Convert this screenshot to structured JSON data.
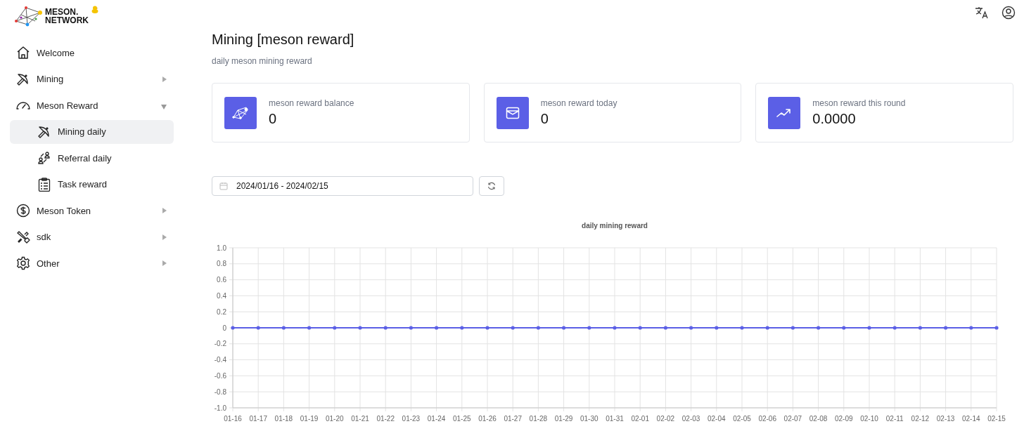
{
  "logo": {
    "line1": "MESON.",
    "line2": "NETWORK"
  },
  "sidebar": {
    "items": [
      {
        "label": "Welcome",
        "kind": "link",
        "selected": false
      },
      {
        "label": "Mining",
        "kind": "group",
        "expanded": false,
        "selected": false
      },
      {
        "label": "Meson Reward",
        "kind": "group",
        "expanded": true,
        "selected": false,
        "children": [
          {
            "label": "Mining daily",
            "selected": true
          },
          {
            "label": "Referral daily",
            "selected": false
          },
          {
            "label": "Task reward",
            "selected": false
          }
        ]
      },
      {
        "label": "Meson Token",
        "kind": "group",
        "expanded": false,
        "selected": false
      },
      {
        "label": "sdk",
        "kind": "group",
        "expanded": false,
        "selected": false
      },
      {
        "label": "Other",
        "kind": "group",
        "expanded": false,
        "selected": false
      }
    ]
  },
  "page": {
    "title": "Mining [meson reward]",
    "subtitle": "daily meson mining reward"
  },
  "cards": [
    {
      "label": "meson reward balance",
      "value": "0"
    },
    {
      "label": "meson reward today",
      "value": "0"
    },
    {
      "label": "meson reward this round",
      "value": "0.0000"
    }
  ],
  "date_range": {
    "value": "2024/01/16 - 2024/02/15"
  },
  "chart": {
    "chart_data": {
      "type": "line",
      "title": "daily mining reward",
      "categories": [
        "01-16",
        "01-17",
        "01-18",
        "01-19",
        "01-20",
        "01-21",
        "01-22",
        "01-23",
        "01-24",
        "01-25",
        "01-26",
        "01-27",
        "01-28",
        "01-29",
        "01-30",
        "01-31",
        "02-01",
        "02-02",
        "02-03",
        "02-04",
        "02-05",
        "02-06",
        "02-07",
        "02-08",
        "02-09",
        "02-10",
        "02-11",
        "02-12",
        "02-13",
        "02-14",
        "02-15"
      ],
      "series": [
        {
          "color": "#5b5fe6",
          "values": [
            0,
            0,
            0,
            0,
            0,
            0,
            0,
            0,
            0,
            0,
            0,
            0,
            0,
            0,
            0,
            0,
            0,
            0,
            0,
            0,
            0,
            0,
            0,
            0,
            0,
            0,
            0,
            0,
            0,
            0,
            0
          ]
        }
      ],
      "ylim": [
        -1,
        1
      ],
      "grid": true,
      "yticks": [
        {
          "value": 1,
          "label": "1.0"
        },
        {
          "value": 0.8,
          "label": "0.8"
        },
        {
          "value": 0.6,
          "label": "0.6"
        },
        {
          "value": 0.4,
          "label": "0.4"
        },
        {
          "value": 0.2,
          "label": "0.2"
        },
        {
          "value": 0,
          "label": "0"
        },
        {
          "value": -0.2,
          "label": "-0.2"
        },
        {
          "value": -0.4,
          "label": "-0.4"
        },
        {
          "value": -0.6,
          "label": "-0.6"
        },
        {
          "value": -0.8,
          "label": "-0.8"
        },
        {
          "value": -1,
          "label": "-1.0"
        }
      ]
    }
  }
}
